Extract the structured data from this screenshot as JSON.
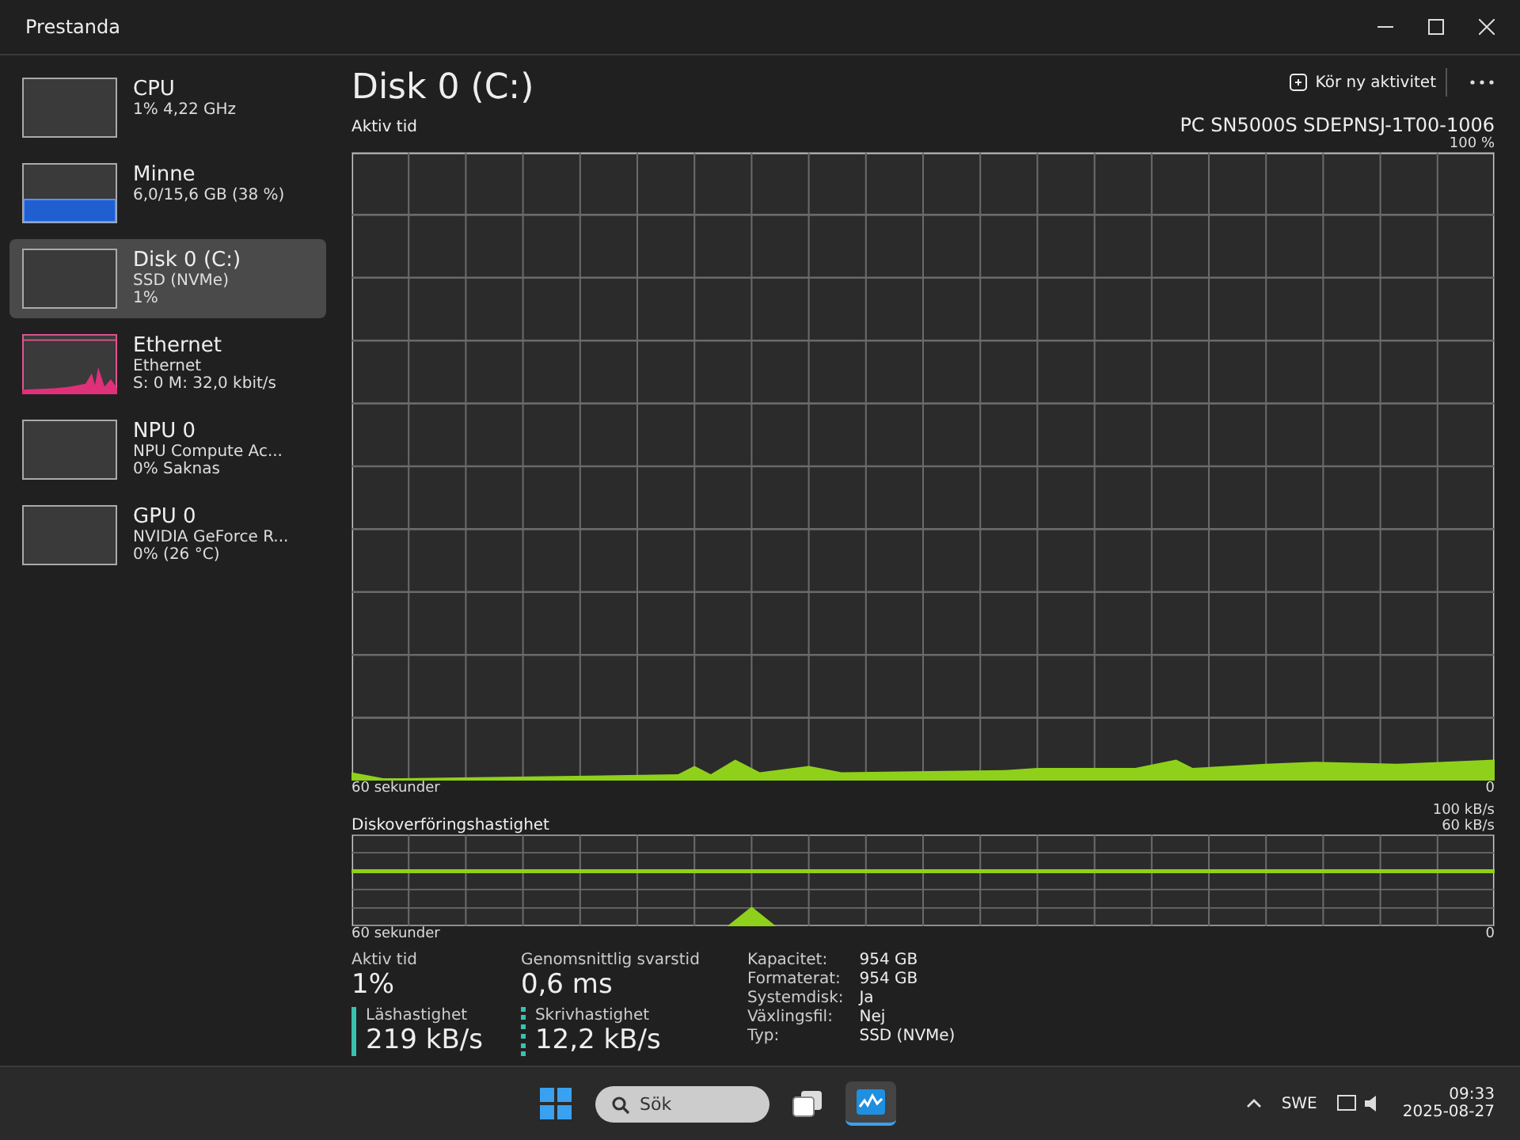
{
  "window": {
    "title": "Prestanda"
  },
  "sidebar": {
    "items": [
      {
        "name": "CPU",
        "lines": [
          "1% 4,22 GHz"
        ],
        "kind": "blank",
        "selected": false
      },
      {
        "name": "Minne",
        "lines": [
          "6,0/15,6 GB (38 %)"
        ],
        "kind": "memory",
        "selected": false
      },
      {
        "name": "Disk 0 (C:)",
        "lines": [
          "SSD (NVMe)",
          "1%"
        ],
        "kind": "blank",
        "selected": true
      },
      {
        "name": "Ethernet",
        "lines": [
          "Ethernet",
          "S: 0 M: 32,0 kbit/s"
        ],
        "kind": "network",
        "selected": false
      },
      {
        "name": "NPU 0",
        "lines": [
          "NPU Compute Ac...",
          "0% Saknas"
        ],
        "kind": "blank",
        "selected": false
      },
      {
        "name": "GPU 0",
        "lines": [
          "NVIDIA GeForce R...",
          "0% (26 °C)"
        ],
        "kind": "blank",
        "selected": false
      }
    ]
  },
  "header": {
    "title": "Disk 0 (C:)",
    "run_task_button": "Kör ny aktivitet",
    "model": "PC SN5000S SDEPNSJ-1T00-1006"
  },
  "activity_chart": {
    "label": "Aktiv tid",
    "max_label": "100 %",
    "min_label": "0",
    "time_label": "60 sekunder"
  },
  "transfer_chart": {
    "label": "Diskoverföringshastighet",
    "max_labels": [
      "100 kB/s",
      "60 kB/s"
    ],
    "min_label": "0",
    "time_label": "60 sekunder"
  },
  "stats": {
    "big": [
      {
        "label": "Aktiv tid",
        "value": "1%",
        "kind": "plain"
      },
      {
        "label": "Genomsnittlig svarstid",
        "value": "0,6 ms",
        "kind": "plain"
      },
      {
        "label": "Läshastighet",
        "value": "219 kB/s",
        "kind": "solid"
      },
      {
        "label": "Skrivhastighet",
        "value": "12,2 kB/s",
        "kind": "dotted"
      }
    ],
    "props": [
      {
        "label": "Kapacitet:",
        "value": "954 GB"
      },
      {
        "label": "Formaterat:",
        "value": "954 GB"
      },
      {
        "label": "Systemdisk:",
        "value": "Ja"
      },
      {
        "label": "Växlingsfil:",
        "value": "Nej"
      },
      {
        "label": "Typ:",
        "value": "SSD (NVMe)"
      }
    ]
  },
  "taskbar": {
    "search_placeholder": "Sök",
    "language": "SWE",
    "time": "09:33",
    "date": "2025-08-27"
  }
}
